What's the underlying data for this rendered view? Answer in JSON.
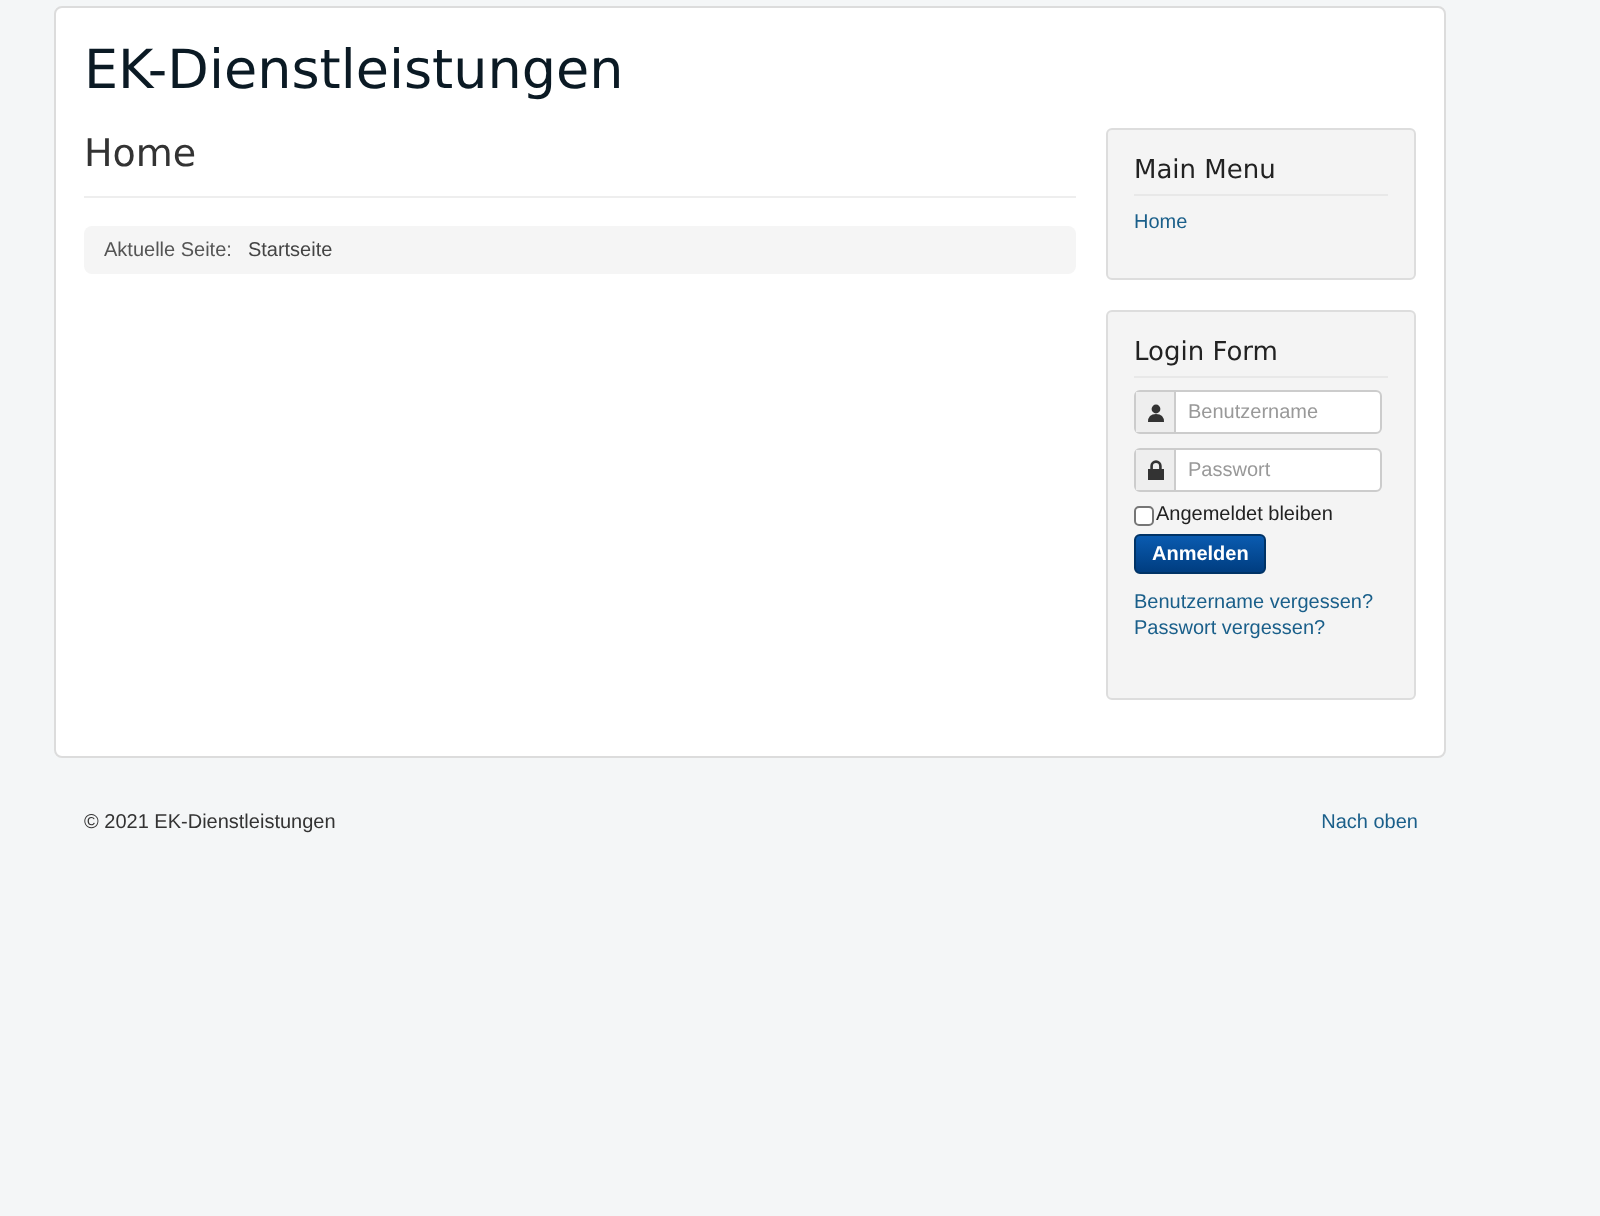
{
  "site_title": "EK-Dienstleistungen",
  "page_title": "Home",
  "breadcrumb": {
    "label": "Aktuelle Seite:",
    "current": "Startseite"
  },
  "main_menu": {
    "title": "Main Menu",
    "items": [
      {
        "label": "Home"
      }
    ]
  },
  "login_form": {
    "title": "Login Form",
    "username": {
      "placeholder": "Benutzername"
    },
    "password": {
      "placeholder": "Passwort"
    },
    "remember": {
      "label": "Angemeldet bleiben",
      "checked": false
    },
    "submit": "Anmelden",
    "links": [
      "Benutzername vergessen?",
      "Passwort vergessen?"
    ]
  },
  "footer": {
    "copyright": "© 2021 EK-Dienstleistungen",
    "back_to_top": "Nach oben"
  }
}
